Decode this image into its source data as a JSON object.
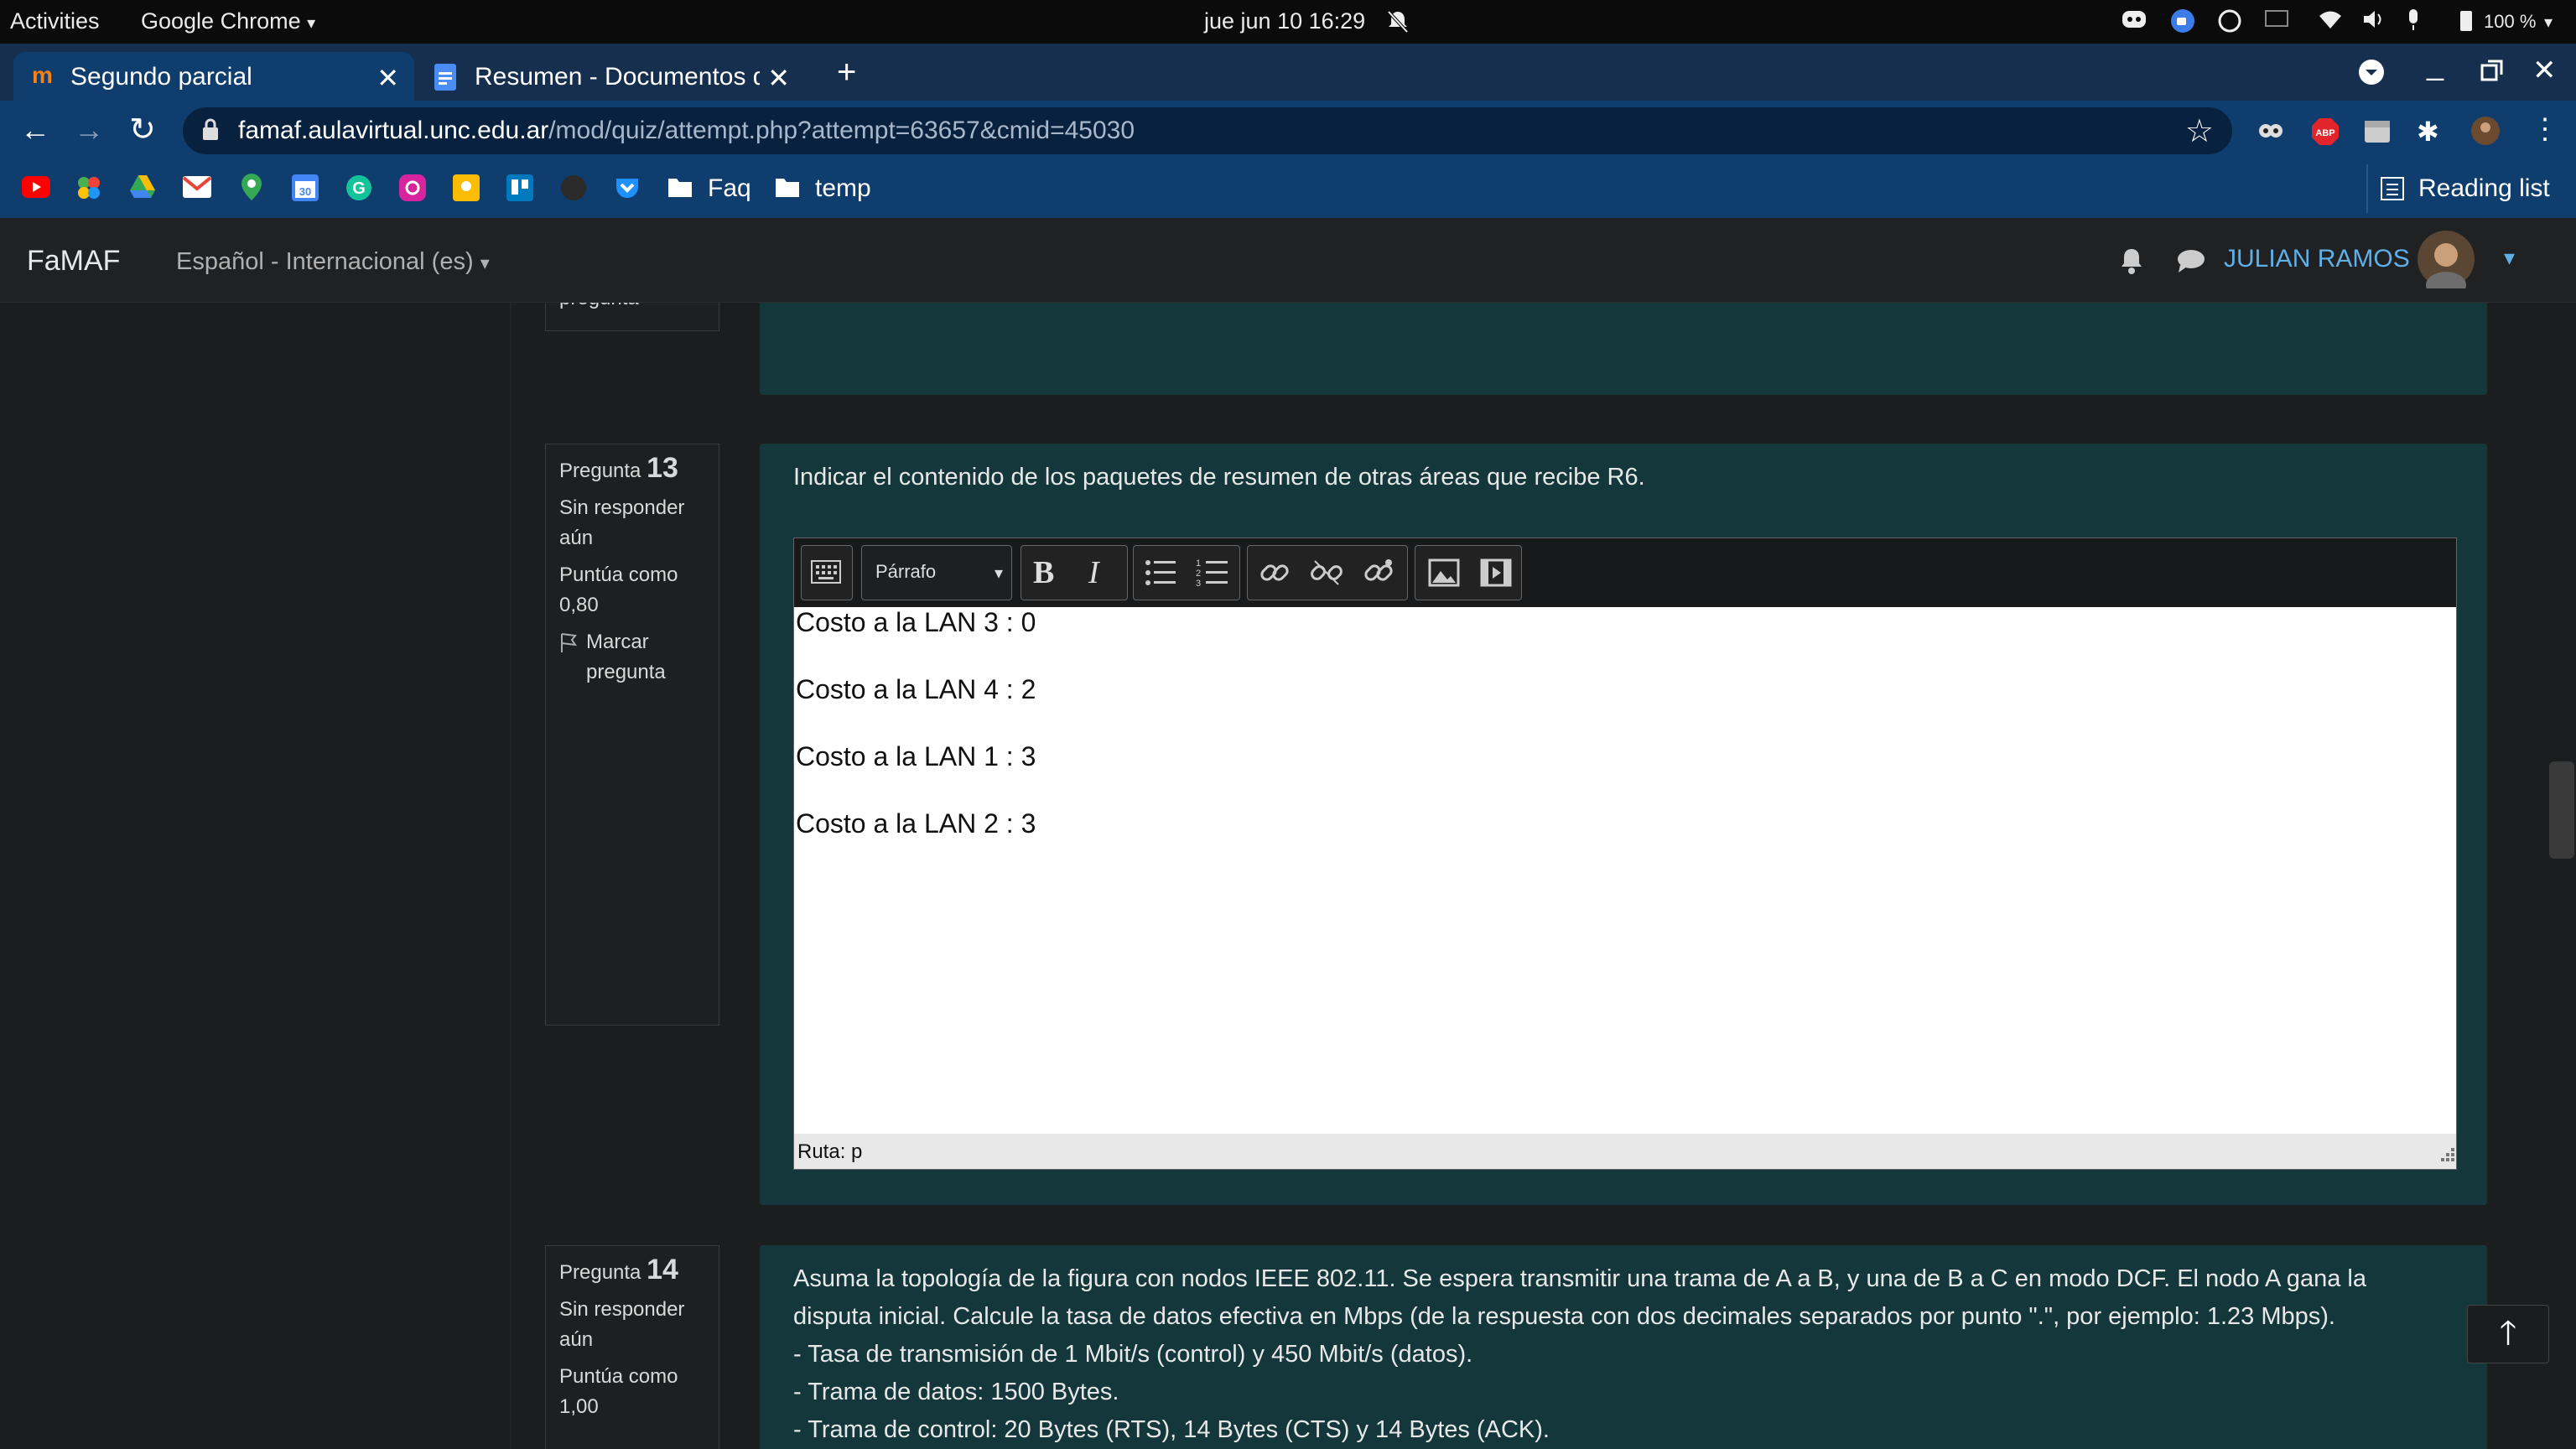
{
  "system": {
    "activities": "Activities",
    "app_menu": "Google Chrome",
    "clock": "jue jun 10  16:29",
    "battery": "100 %"
  },
  "browser": {
    "tabs": [
      {
        "label": "Segundo parcial",
        "active": true
      },
      {
        "label": "Resumen - Documentos d",
        "active": false
      }
    ],
    "url_host": "famaf.aulavirtual.unc.edu.ar",
    "url_path": "/mod/quiz/attempt.php?attempt=63657&cmid=45030",
    "bookmarks": [
      {
        "label": "Faq"
      },
      {
        "label": "temp"
      }
    ],
    "reading_list": "Reading list"
  },
  "site": {
    "brand": "FaMAF",
    "language": "Español - Internacional (es)",
    "user_name": "JULIAN RAMOS"
  },
  "prev_question": {
    "flag_partial": "pregunta"
  },
  "questions": [
    {
      "label": "Pregunta",
      "number": "13",
      "state": "Sin responder aún",
      "grade": "Puntúa como 0,80",
      "flag": "Marcar pregunta",
      "prompt": "Indicar el contenido de los paquetes de resumen de otras áreas que recibe R6.",
      "editor": {
        "format_select": "Párrafo",
        "lines": [
          "Costo a la LAN 3 : 0",
          "Costo a la LAN 4 : 2",
          "Costo a la LAN 1 : 3",
          "Costo a la LAN 2 : 3"
        ],
        "path": "Ruta: p"
      }
    },
    {
      "label": "Pregunta",
      "number": "14",
      "state": "Sin responder aún",
      "grade": "Puntúa como 1,00",
      "prompt_lines": [
        "Asuma la topología de la figura con nodos IEEE 802.11. Se espera transmitir una trama de A a B, y una de B a C en modo DCF. El nodo A gana la",
        "disputa inicial. Calcule la tasa de datos efectiva en Mbps (de la respuesta con dos decimales separados por punto \".\", por ejemplo: 1.23 Mbps).",
        "- Tasa de transmisión de 1 Mbit/s (control) y 450 Mbit/s (datos).",
        "- Trama de datos: 1500 Bytes.",
        "- Trama de control: 20 Bytes (RTS), 14 Bytes (CTS) y 14 Bytes (ACK)."
      ]
    }
  ],
  "colors": {
    "accent_blue": "#5fb0e8",
    "question_bg": "#13373b",
    "chrome_toolbar": "#0e3d6e"
  }
}
